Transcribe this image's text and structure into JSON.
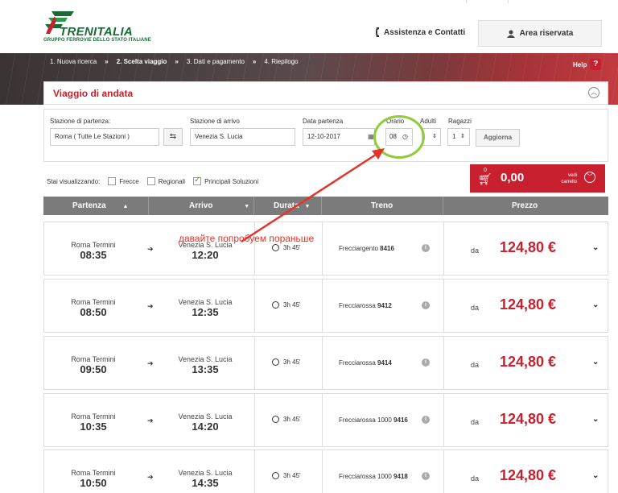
{
  "header": {
    "brand": "TRENITALIA",
    "brand_sub": "GRUPPO FERROVIE DELLO STATO ITALIANE",
    "assist_label": "Assistenza e Contatti",
    "reserved_label": "Area riservata"
  },
  "steps": [
    {
      "label": "1. Nuova ricerca",
      "active": false
    },
    {
      "label": "2. Scelta viaggio",
      "active": true
    },
    {
      "label": "3. Dati e pagamento",
      "active": false
    },
    {
      "label": "4. Riepilogo",
      "active": false
    }
  ],
  "step_separator": "»",
  "help": {
    "label": "Help",
    "icon": "?"
  },
  "trip": {
    "title": "Viaggio di andata"
  },
  "search": {
    "from_label": "Stazione di partenza:",
    "from_value": "Roma ( Tutte Le Stazioni )",
    "to_label": "Stazione di arrivo",
    "to_value": "Venezia S. Lucia",
    "date_label": "Data partenza",
    "date_value": "12-10-2017",
    "time_label": "Orario",
    "time_value": "08",
    "adults_label": "Adulti",
    "adults_value": "",
    "kids_label": "Ragazzi",
    "kids_value": "1",
    "update_label": "Aggiorna"
  },
  "filters": {
    "label": "Stai visualizzando:",
    "options": [
      {
        "label": "Frecce",
        "checked": false
      },
      {
        "label": "Regionali",
        "checked": false
      },
      {
        "label": "Principali Soluzioni",
        "checked": true
      }
    ]
  },
  "cart": {
    "count": "0",
    "total": "0,00",
    "link_line1": "vedi",
    "link_line2": "carrello"
  },
  "table": {
    "headers": {
      "departure": "Partenza",
      "arrival": "Arrivo",
      "duration": "Durata",
      "train": "Treno",
      "price": "Prezzo"
    },
    "rows": [
      {
        "from": "Roma Termini",
        "dep": "08:35",
        "to": "Venezia S. Lucia",
        "arr": "12:20",
        "duration": "3h 45'",
        "train_name": "Frecciargento",
        "train_no": "8416",
        "da": "da",
        "price": "124,80 €"
      },
      {
        "from": "Roma Termini",
        "dep": "08:50",
        "to": "Venezia S. Lucia",
        "arr": "12:35",
        "duration": "3h 45'",
        "train_name": "Frecciarossa",
        "train_no": "9412",
        "da": "da",
        "price": "124,80 €"
      },
      {
        "from": "Roma Termini",
        "dep": "09:50",
        "to": "Venezia S. Lucia",
        "arr": "13:35",
        "duration": "3h 45'",
        "train_name": "Frecciarossa",
        "train_no": "9414",
        "da": "da",
        "price": "124,80 €"
      },
      {
        "from": "Roma Termini",
        "dep": "10:35",
        "to": "Venezia S. Lucia",
        "arr": "14:20",
        "duration": "3h 45'",
        "train_name": "Frecciarossa 1000",
        "train_no": "9416",
        "da": "da",
        "price": "124,80 €"
      },
      {
        "from": "Roma Termini",
        "dep": "10:50",
        "to": "Venezia S. Lucia",
        "arr": "14:35",
        "duration": "3h 45'",
        "train_name": "Frecciarossa 1000",
        "train_no": "9418",
        "da": "da",
        "price": "124,80 €"
      }
    ]
  },
  "annotation": {
    "text": "давайте попробуем пораньше",
    "color": "#e5332a",
    "circle_color": "#8ecc3c"
  },
  "colors": {
    "brand_red": "#c8202e",
    "brand_green": "#1b6a36",
    "table_header": "#7b7b7b"
  }
}
